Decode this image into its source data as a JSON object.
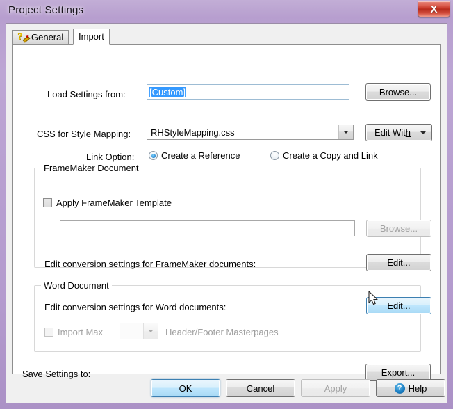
{
  "window": {
    "title": "Project Settings",
    "close_label": "X",
    "accent_titlebar": "#b79fd0",
    "accent_close": "#c43424"
  },
  "tabs": [
    {
      "label": "General",
      "icon": "question-pencil-icon",
      "active": false
    },
    {
      "label": "Import",
      "icon": "",
      "active": true
    }
  ],
  "import_tab": {
    "load_settings": {
      "label": "Load Settings from:",
      "value": "[Custom]",
      "browse_label": "Browse..."
    },
    "css_mapping": {
      "label": "CSS for Style Mapping:",
      "value": "RHStyleMapping.css",
      "edit_with_label_part1": "Edit Wit",
      "edit_with_label_accel": "h"
    },
    "link_option": {
      "label": "Link Option:",
      "options": [
        {
          "label": "Create a Reference",
          "selected": true
        },
        {
          "label": "Create a Copy and Link",
          "selected": false
        }
      ]
    },
    "framemaker_group": {
      "title": "FrameMaker Document",
      "apply_template_label": "Apply FrameMaker Template",
      "apply_template_checked": false,
      "template_path_value": "",
      "browse_label": "Browse...",
      "browse_disabled": true,
      "edit_conversion_label": "Edit conversion settings for FrameMaker documents:",
      "edit_label": "Edit..."
    },
    "word_group": {
      "title": "Word Document",
      "edit_conversion_label": "Edit conversion settings for Word documents:",
      "edit_label": "Edit...",
      "edit_hovered": true,
      "import_max_label": "Import Max",
      "import_max_checked": false,
      "import_max_disabled": true,
      "masterpages_value": "",
      "masterpages_label": "Header/Footer Masterpages",
      "masterpages_disabled": true
    },
    "save_settings": {
      "label": "Save Settings to:",
      "export_label": "Export..."
    }
  },
  "footer": {
    "ok_label": "OK",
    "cancel_label": "Cancel",
    "apply_label": "Apply",
    "apply_disabled": true,
    "help_label": "Help",
    "help_icon_char": "?"
  }
}
